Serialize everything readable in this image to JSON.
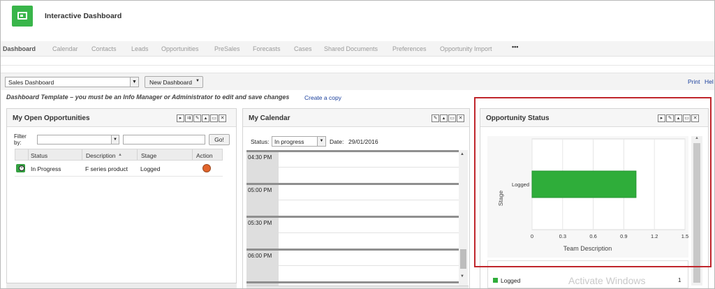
{
  "header": {
    "title": "Interactive Dashboard"
  },
  "nav": {
    "items": [
      "Dashboard",
      "Calendar",
      "Contacts",
      "Leads",
      "Opportunities",
      "PreSales",
      "Forecasts",
      "Cases",
      "Shared Documents",
      "Preferences",
      "Opportunity Import"
    ],
    "more": "•••",
    "active": "Dashboard"
  },
  "toolbar": {
    "dashboard_select": "Sales Dashboard",
    "new_dashboard": "New Dashboard",
    "print": "Print",
    "help": "Hel"
  },
  "template_note": "Dashboard Template – you must be an Info Manager or Administrator to edit and save changes",
  "create_copy": "Create a copy",
  "opportunities": {
    "title": "My Open Opportunities",
    "filter_label_1": "Filter",
    "filter_label_2": "by:",
    "go": "Go!",
    "columns": [
      "Status",
      "Description",
      "Stage",
      "Action"
    ],
    "sort_indicator": "▲",
    "rows": [
      {
        "status": "In Progress",
        "description": "F series product",
        "stage": "Logged"
      }
    ]
  },
  "calendar": {
    "title": "My Calendar",
    "status_label": "Status:",
    "status_value": "In progress",
    "date_label": "Date:",
    "date_value": "29/01/2016",
    "times": [
      "04:30 PM",
      "05:00 PM",
      "05:30 PM",
      "06:00 PM"
    ]
  },
  "status_panel": {
    "title": "Opportunity Status",
    "legend": [
      {
        "name": "Logged",
        "value": "1"
      }
    ],
    "watermark": "Activate Windows"
  },
  "chart_data": {
    "type": "bar",
    "orientation": "horizontal",
    "categories": [
      "Logged"
    ],
    "values": [
      1.02
    ],
    "xlabel": "Team Description",
    "ylabel": "Stage",
    "xlim": [
      0,
      1.5
    ],
    "xticks": [
      "0",
      "0.3",
      "0.6",
      "0.9",
      "1.2",
      "1.5"
    ],
    "grid": true,
    "color": "#2fad3a"
  },
  "colors": {
    "accent_green": "#39b54a",
    "highlight_red": "#c0262c",
    "link_blue": "#1a3f9c",
    "action_orange": "#e2642b"
  },
  "icons": {
    "logo": "dashboard-logo-icon",
    "row": "opportunity-add-icon",
    "action": "status-dot-icon"
  }
}
